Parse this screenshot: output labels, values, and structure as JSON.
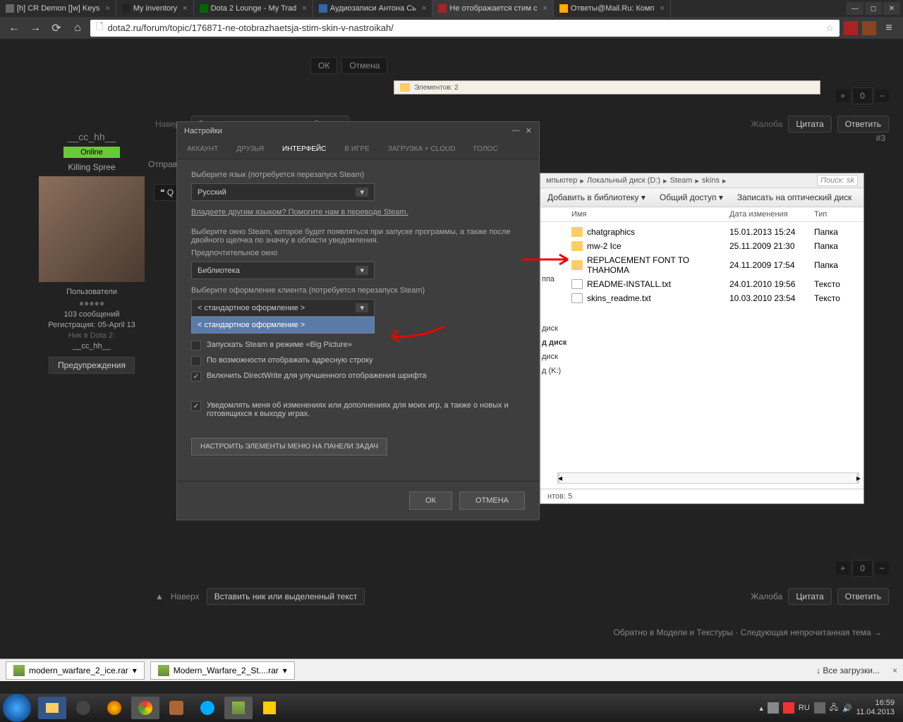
{
  "browser": {
    "tabs": [
      {
        "label": "[h] CR Demon []w] Keys"
      },
      {
        "label": "My inventory"
      },
      {
        "label": "Dota 2 Lounge - My Trad"
      },
      {
        "label": "Аудиозаписи Антона Сь"
      },
      {
        "label": "Не отображается стим с",
        "active": true
      },
      {
        "label": "Ответы@Mail.Ru: Комп"
      }
    ],
    "url": "dota2.ru/forum/topic/176871-ne-otobrazhaetsja-stim-skin-v-nastroikah/"
  },
  "forum": {
    "user": {
      "name": "__cc_hh__",
      "status": "Online",
      "title": "Killing Spree",
      "role": "Пользователи",
      "posts": "103 сообщений",
      "reg": "Регистрация: 05-April 13",
      "nick_label": "Ник в Dota 2:",
      "nick": "__cc_hh__",
      "warn": "Предупреждения"
    },
    "post_num": "#3",
    "top_label": "Наверх",
    "insert_nick": "Вставить ник или выделенный текст",
    "complaint": "Жалоба",
    "quote": "Цитата",
    "reply": "Ответить",
    "vote_count": "0",
    "sending": "Отправ",
    "quote_btn": "Q",
    "footer_nav": "Обратно в Модели и Текстуры · Следующая непрочитанная тема →"
  },
  "steam": {
    "title": "Настройки",
    "tabs": [
      "АККАУНТ",
      "ДРУЗЬЯ",
      "ИНТЕРФЕЙС",
      "В ИГРЕ",
      "ЗАГРУЗКА + CLOUD",
      "ГОЛОС"
    ],
    "active_tab": 2,
    "lang_label": "Выберите язык (потребуется перезапуск Steam)",
    "lang_value": "Русский",
    "lang_link": "Владеете другим языком? Помогите нам в переводе Steam.",
    "window_desc": "Выберите окно Steam, которое будет появляться при запуске программы, а также после двойного щелчка по значку в области уведомления.",
    "window_label": "Предпочтительное окно",
    "window_value": "Библиотека",
    "skin_label": "Выберите оформление клиента (потребуется перезапуск Steam)",
    "skin_value": "< стандартное оформление >",
    "skin_dropdown": "< стандартное оформление >",
    "check1": "Запускать Steam в режиме «Big Picture»",
    "check2": "По возможности отображать адресную строку",
    "check3": "Включить DirectWrite для улучшенного отображения шрифта",
    "check4": "Уведомлять меня об изменениях или дополнениях для моих игр, а также о новых и готовящихся к выходу играх.",
    "taskbar_btn": "НАСТРОИТЬ ЭЛЕМЕНТЫ МЕНЮ НА ПАНЕЛИ ЗАДАЧ",
    "ok": "ОК",
    "cancel": "ОТМЕНА"
  },
  "mini_explorer": {
    "text": "Элементов: 2"
  },
  "explorer": {
    "crumbs": [
      "мпьютер",
      "Локальный диск (D:)",
      "Steam",
      "skins"
    ],
    "search_placeholder": "Поиск: sk",
    "toolbar": [
      "Добавить в библиотеку ▾",
      "Общий доступ ▾",
      "Записать на оптический диск"
    ],
    "columns": {
      "name": "Имя",
      "date": "Дата изменения",
      "type": "Тип"
    },
    "files": [
      {
        "name": "chatgraphics",
        "date": "15.01.2013 15:24",
        "type": "Папка",
        "icon": "folder"
      },
      {
        "name": "mw-2 Ice",
        "date": "25.11.2009 21:30",
        "type": "Папка",
        "icon": "folder"
      },
      {
        "name": "REPLACEMENT FONT TO THAHOMA",
        "date": "24.11.2009 17:54",
        "type": "Папка",
        "icon": "folder"
      },
      {
        "name": "README-INSTALL.txt",
        "date": "24.01.2010 19:56",
        "type": "Тексто",
        "icon": "txt"
      },
      {
        "name": "skins_readme.txt",
        "date": "10.03.2010 23:54",
        "type": "Тексто",
        "icon": "txt"
      }
    ],
    "sidebar_fragments": [
      "ппа",
      "диск",
      "д диск",
      "диск",
      "д (K:)"
    ],
    "status": "нтов: 5"
  },
  "downloads": {
    "items": [
      "modern_warfare_2_ice.rar",
      "Modern_Warfare_2_St....rar"
    ],
    "all": "Все загрузки..."
  },
  "taskbar": {
    "lang": "RU",
    "time": "16:59",
    "date": "11.04.2013"
  },
  "small_buttons": {
    "ok": "ОК",
    "cancel": "Отмена"
  }
}
